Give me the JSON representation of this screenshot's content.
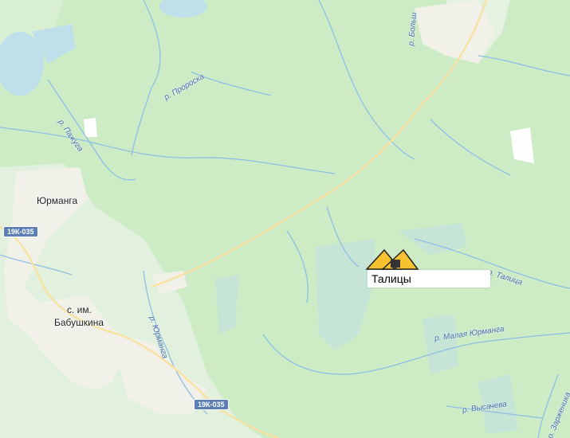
{
  "map": {
    "colors": {
      "forest": "#cdecc6",
      "clearing": "#e4f2df",
      "water": "#bfe0ea",
      "river": "#8fbde4",
      "road": "#f7e2a4",
      "village": "#f1f1ea",
      "badge": "#5b7fb5",
      "marker_accent": "#f6c230"
    },
    "places": {
      "yurmanga": "Юрманга",
      "babushkina_line1": "с. им.",
      "babushkina_line2": "Бабушкина"
    },
    "rivers": {
      "proroska": "р. Пророска",
      "pazhuga": "р. Пажуга",
      "yurmanga": "р. Юрманга",
      "bolsh": "р. Больш",
      "talitsa": "р. Талица",
      "malaya_yurmanga": "р. Малая Юрманга",
      "vysacheva": "р. Высачева",
      "zarzhenika": "р. Зарженика"
    },
    "roads": {
      "badge1": "19К-035",
      "badge2": "19К-035"
    },
    "marker": {
      "label": "Талицы",
      "icon": "mine-pin-icon"
    }
  }
}
